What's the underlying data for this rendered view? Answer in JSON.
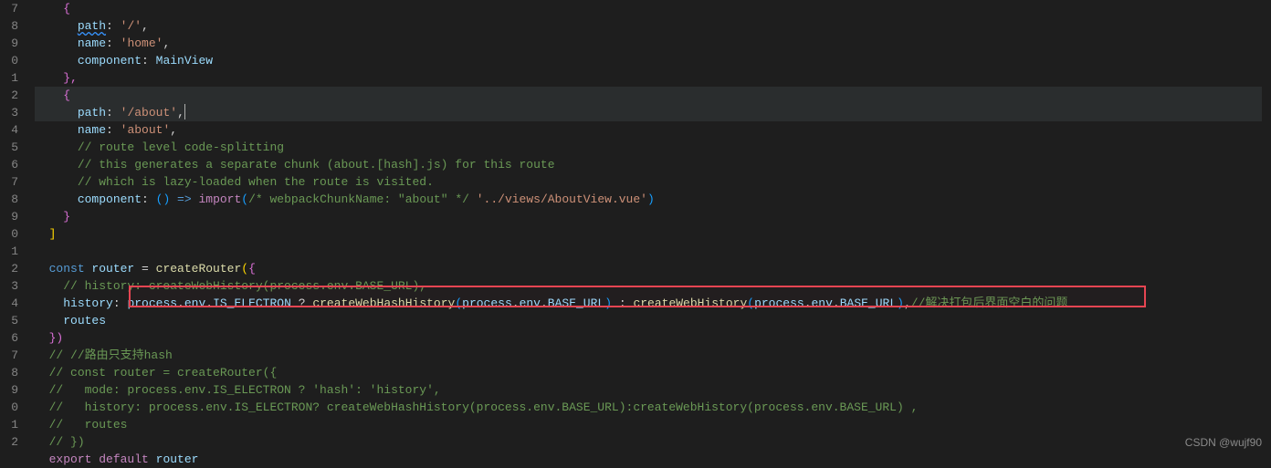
{
  "lineNumbers": [
    "7",
    "8",
    "9",
    "0",
    "1",
    "2",
    "3",
    "4",
    "5",
    "6",
    "7",
    "8",
    "9",
    "0",
    "1",
    "2",
    "3",
    "4",
    "5",
    "6",
    "7",
    "8",
    "9",
    "0",
    "1",
    "2"
  ],
  "code": {
    "l7": {
      "indent": "    ",
      "brace": "{"
    },
    "l8": {
      "indent": "      ",
      "key": "path",
      "colon": ": ",
      "val": "'/'",
      "tail": ","
    },
    "l9": {
      "indent": "      ",
      "key": "name",
      "colon": ": ",
      "val": "'home'",
      "tail": ","
    },
    "l10": {
      "indent": "      ",
      "key": "component",
      "colon": ": ",
      "val": "MainView"
    },
    "l11": {
      "indent": "    ",
      "brace": "},"
    },
    "l12": {
      "indent": "    ",
      "brace": "{"
    },
    "l13": {
      "indent": "      ",
      "key": "path",
      "colon": ": ",
      "val": "'/about'",
      "tail": ","
    },
    "l14": {
      "indent": "      ",
      "key": "name",
      "colon": ": ",
      "val": "'about'",
      "tail": ","
    },
    "l15": {
      "indent": "      ",
      "cmt": "// route level code-splitting"
    },
    "l16": {
      "indent": "      ",
      "cmt": "// this generates a separate chunk (about.[hash].js) for this route"
    },
    "l17": {
      "indent": "      ",
      "cmt": "// which is lazy-loaded when the route is visited."
    },
    "l18": {
      "indent": "      ",
      "key": "component",
      "colon": ": ",
      "paren": "()",
      "arrow": " => ",
      "fn": "import",
      "po": "(",
      "icmt": "/* webpackChunkName: \"about\" */ ",
      "str": "'../views/AboutView.vue'",
      "pc": ")"
    },
    "l19": {
      "indent": "    ",
      "brace": "}"
    },
    "l20": {
      "indent": "  ",
      "brace": "]"
    },
    "l21": {
      "blank": ""
    },
    "l22": {
      "indent": "  ",
      "kw": "const ",
      "name": "router",
      "eq": " = ",
      "fn": "createRouter",
      "po": "(",
      "brace": "{"
    },
    "l23": {
      "indent": "    ",
      "cmt": "// history: createWebHistory(process.env.BASE_URL),"
    },
    "l24": {
      "indent": "    ",
      "key": "history",
      "colon": ": ",
      "p1": "process",
      "d1": ".",
      "p2": "env",
      "d2": ".",
      "p3": "IS_ELECTRON",
      "q": " ? ",
      "fn1": "createWebHashHistory",
      "po1": "(",
      "a1": "process",
      "a1d": ".",
      "a2": "env",
      "a2d": ".",
      "a3": "BASE_URL",
      "pc1": ")",
      "alt": " : ",
      "fn2": "createWebHistory",
      "po2": "(",
      "b1": "process",
      "b1d": ".",
      "b2": "env",
      "b2d": ".",
      "b3": "BASE_URL",
      "pc2": ")",
      "tail": ",",
      "cmt": "//解决打包后界面空白的问题"
    },
    "l25": {
      "indent": "    ",
      "key": "routes"
    },
    "l26": {
      "indent": "  ",
      "brace": "})"
    },
    "l27": {
      "indent": "  ",
      "cmt": "// //路由只支持hash"
    },
    "l28": {
      "indent": "  ",
      "cmt": "// const router = createRouter({"
    },
    "l29": {
      "indent": "  ",
      "cmt": "//   mode: process.env.IS_ELECTRON ? 'hash': 'history',"
    },
    "l30": {
      "indent": "  ",
      "cmt": "//   history: process.env.IS_ELECTRON? createWebHashHistory(process.env.BASE_URL):createWebHistory(process.env.BASE_URL) ,"
    },
    "l31": {
      "indent": "  ",
      "cmt": "//   routes"
    },
    "l32": {
      "indent": "  ",
      "cmt": "// })"
    },
    "l33": {
      "indent": "  ",
      "kw1": "export ",
      "kw2": "default ",
      "name": "router"
    }
  },
  "watermark": "CSDN @wujf90"
}
